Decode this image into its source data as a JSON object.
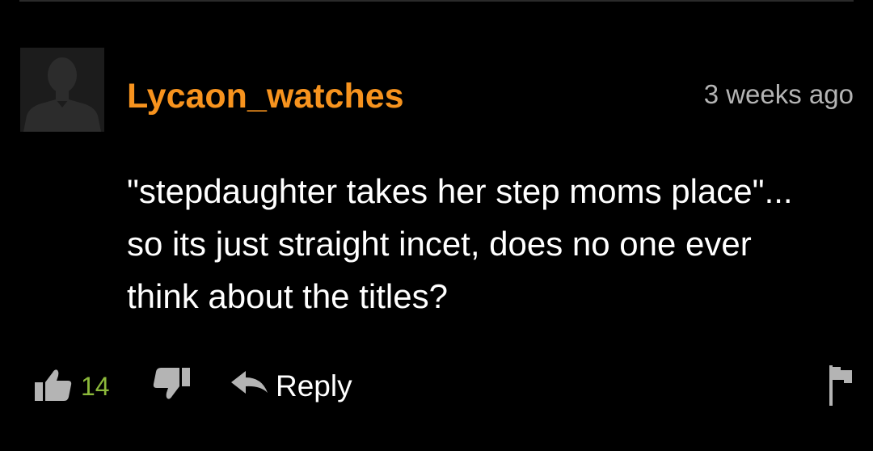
{
  "comment": {
    "username": "Lycaon_watches",
    "timestamp": "3 weeks ago",
    "lines": [
      "\"stepdaughter takes her step moms place\"...",
      "so its just straight incet, does no one ever",
      "think about the titles?"
    ]
  },
  "actions": {
    "like_count": "14",
    "reply_label": "Reply"
  },
  "icons": {
    "avatar": "default-avatar-silhouette",
    "like": "thumbs-up-icon",
    "dislike": "thumbs-down-icon",
    "reply": "reply-arrow-icon",
    "flag": "flag-icon"
  },
  "colors": {
    "background": "#000000",
    "username": "#f7931e",
    "like_count": "#8bb83a",
    "timestamp": "#b4b4b4",
    "icon": "#b4b4b4",
    "text": "#ffffff"
  }
}
